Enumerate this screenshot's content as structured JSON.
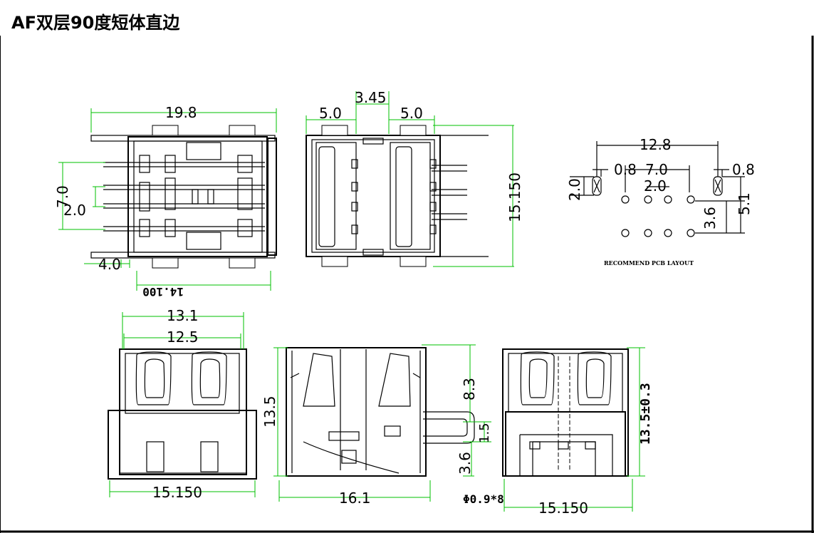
{
  "title": "AF双层90度短体直边",
  "colors": {
    "dimension": "#00c000",
    "outline": "#000000",
    "border": "#000000"
  },
  "pcb_layout_label": "RECOMMEND PCB LAYOUT",
  "dimensions": {
    "top_width": "19.8",
    "top_pin_pitch": "7.0",
    "top_pin_spacing": "2.0",
    "top_offset": "4.0",
    "top_body_depth": "14.100",
    "front_left_gap": "5.0",
    "front_center": "3.45",
    "front_right_gap": "5.0",
    "front_height": "15.150",
    "pcb_width": "12.8",
    "pcb_left_slot": "0.8",
    "pcb_span": "7.0",
    "pcb_right_slot": "0.8",
    "pcb_slot_h": "2.0",
    "pcb_pin_pitch": "2.0",
    "pcb_row_gap": "3.6",
    "pcb_height": "5.1",
    "bottom_outer": "13.1",
    "bottom_inner": "12.5",
    "bottom_width": "15.150",
    "side_height": "13.5",
    "side_depth": "16.1",
    "side_top": "8.3",
    "side_mid": "1.5",
    "side_pin": "3.6",
    "pin_hole": "Φ0.9*8",
    "rear_width": "15.150",
    "rear_height": "13.5±0.3"
  }
}
